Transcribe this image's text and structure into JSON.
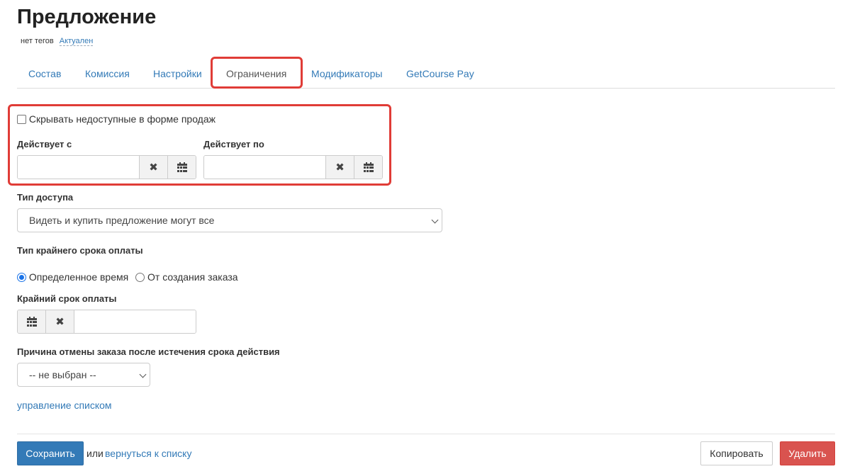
{
  "page": {
    "title": "Предложение",
    "tags_text": "нет тегов",
    "status_link": "Актуален"
  },
  "tabs": [
    {
      "label": "Состав"
    },
    {
      "label": "Комиссия"
    },
    {
      "label": "Настройки"
    },
    {
      "label": "Ограничения",
      "active": true
    },
    {
      "label": "Модификаторы"
    },
    {
      "label": "GetCourse Pay"
    }
  ],
  "restrictions": {
    "hide_unavailable_label": "Скрывать недоступные в форме продаж",
    "hide_unavailable_checked": false,
    "valid_from_label": "Действует с",
    "valid_from_value": "",
    "valid_to_label": "Действует по",
    "valid_to_value": ""
  },
  "access": {
    "label": "Тип доступа",
    "selected": "Видеть и купить предложение могут все"
  },
  "payment_deadline_type": {
    "label": "Тип крайнего срока оплаты",
    "options": [
      {
        "label": "Определенное время",
        "checked": true
      },
      {
        "label": "От создания заказа",
        "checked": false
      }
    ]
  },
  "payment_deadline": {
    "label": "Крайний срок оплаты",
    "value": ""
  },
  "cancel_reason": {
    "label": "Причина отмены заказа после истечения срока действия",
    "selected": "-- не выбран --",
    "manage_link": "управление списком"
  },
  "footer": {
    "save_label": "Сохранить",
    "or_text": "или",
    "back_link": "вернуться к списку",
    "copy_label": "Копировать",
    "delete_label": "Удалить"
  },
  "colors": {
    "accent": "#337ab7",
    "highlight": "#e03c37",
    "danger": "#d9534f"
  }
}
